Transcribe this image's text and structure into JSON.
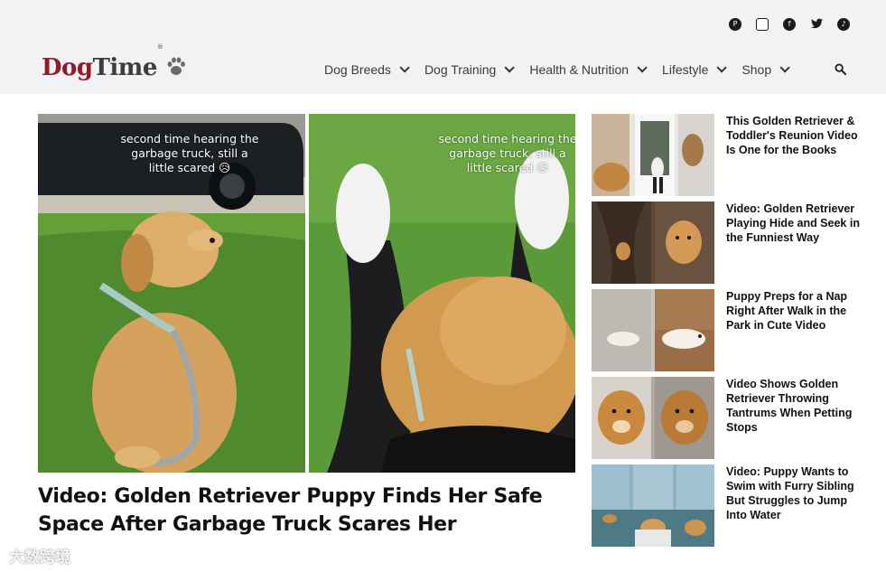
{
  "header": {
    "logo": {
      "part1": "Dog",
      "part2": "Time",
      "reg": "®",
      "paw_icon": "paw-icon"
    },
    "social": [
      {
        "name": "pinterest-icon",
        "glyph": "P"
      },
      {
        "name": "instagram-icon",
        "glyph": "◎"
      },
      {
        "name": "facebook-icon",
        "glyph": "f"
      },
      {
        "name": "twitter-icon",
        "glyph": "🐦"
      },
      {
        "name": "tiktok-icon",
        "glyph": "♪"
      }
    ],
    "nav": [
      {
        "label": "Dog Breeds"
      },
      {
        "label": "Dog Training"
      },
      {
        "label": "Health & Nutrition"
      },
      {
        "label": "Lifestyle"
      },
      {
        "label": "Shop"
      }
    ],
    "search_icon": "search-icon"
  },
  "hero": {
    "caption_left": "second time hearing the garbage truck, still a little scared 😥",
    "caption_right": "second time hearing the garbage truck, still a little scared 😥",
    "title": "Video: Golden Retriever Puppy Finds Her Safe Space After Garbage Truck Scares Her"
  },
  "sidebar": {
    "items": [
      {
        "title": "This Golden Retriever & Toddler's Reunion Video Is One for the Books"
      },
      {
        "title": "Video: Golden Retriever Playing Hide and Seek in the Funniest Way"
      },
      {
        "title": "Puppy Preps for a Nap Right After Walk in the Park in Cute Video"
      },
      {
        "title": "Video Shows Golden Retriever Throwing Tantrums When Petting Stops"
      },
      {
        "title": "Video: Puppy Wants to Swim with Furry Sibling But Struggles to Jump Into Water"
      }
    ]
  },
  "watermark": "大数跨境",
  "colors": {
    "brand_red": "#8e1c2a",
    "header_bg": "#f1f2f4",
    "text": "#111111"
  }
}
